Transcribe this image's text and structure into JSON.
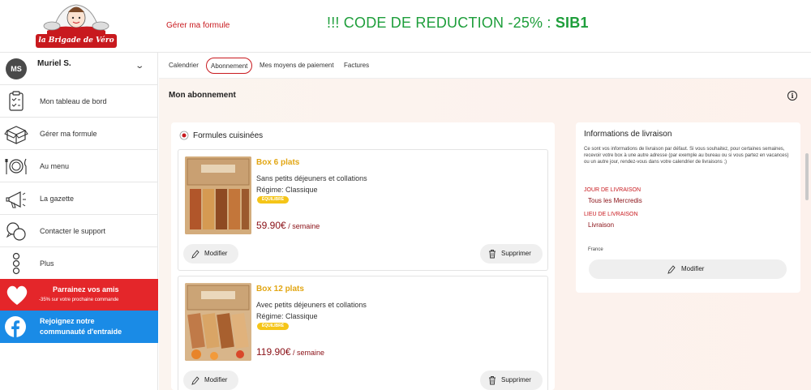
{
  "header": {
    "logo_text": "la Brigade de Véro",
    "link": "Gérer ma formule",
    "promo_prefix": "!!! CODE DE REDUCTION -25% : ",
    "promo_code": "SIB1"
  },
  "sidebar": {
    "user": {
      "initials": "MS",
      "name": "Muriel S."
    },
    "items": [
      {
        "label": "Mon tableau de bord",
        "icon": "clipboard-icon"
      },
      {
        "label": "Gérer ma formule",
        "icon": "box-icon"
      },
      {
        "label": "Au menu",
        "icon": "plate-icon"
      },
      {
        "label": "La gazette",
        "icon": "megaphone-icon"
      },
      {
        "label": "Contacter le support",
        "icon": "chat-icon"
      },
      {
        "label": "Plus",
        "icon": "more-icon"
      }
    ],
    "referral": {
      "title": "Parrainez vos amis",
      "subtitle": "-35% sur votre prochaine commande"
    },
    "facebook": {
      "title": "Rejoignez notre communauté d'entraide"
    }
  },
  "tabs": [
    "Calendrier",
    "Abonnement",
    "Mes moyens de paiement",
    "Factures"
  ],
  "active_tab": "Abonnement",
  "main": {
    "title": "Mon abonnement",
    "formulas": {
      "title": "Formules cuisinées",
      "plans": [
        {
          "name": "Box 6 plats",
          "line1": "Sans petits déjeuners et collations",
          "line2": "Régime: Classique",
          "badge": "ÉQUILIBRÉ",
          "price": "59.90€",
          "unit": " / semaine",
          "modify": "Modifier",
          "delete": "Supprimer"
        },
        {
          "name": "Box 12 plats",
          "line1": "Avec petits déjeuners et collations",
          "line2": "Régime: Classique",
          "badge": "ÉQUILIBRÉ",
          "price": "119.90€",
          "unit": " / semaine",
          "modify": "Modifier",
          "delete": "Supprimer"
        }
      ]
    },
    "delivery": {
      "title": "Informations de livraison",
      "text": "Ce sont vos informations de livraison par défaut. Si vous souhaitez, pour certaines semaines, recevoir votre box à une autre adresse (par exemple au bureau ou si vous partez en vacances) ou un autre jour, rendez-vous dans votre calendrier de livraisons ;)",
      "day_label": "JOUR DE LIVRAISON",
      "day_value": "Tous les Mercredis",
      "place_label": "LIEU DE LIVRAISON",
      "place_value": "Livraison",
      "country": "France",
      "modify": "Modifier"
    }
  },
  "colors": {
    "brand_red": "#c8191e",
    "promo_green": "#1e9e3b",
    "plan_yellow": "#e2a613",
    "facebook_blue": "#1a8be6"
  }
}
